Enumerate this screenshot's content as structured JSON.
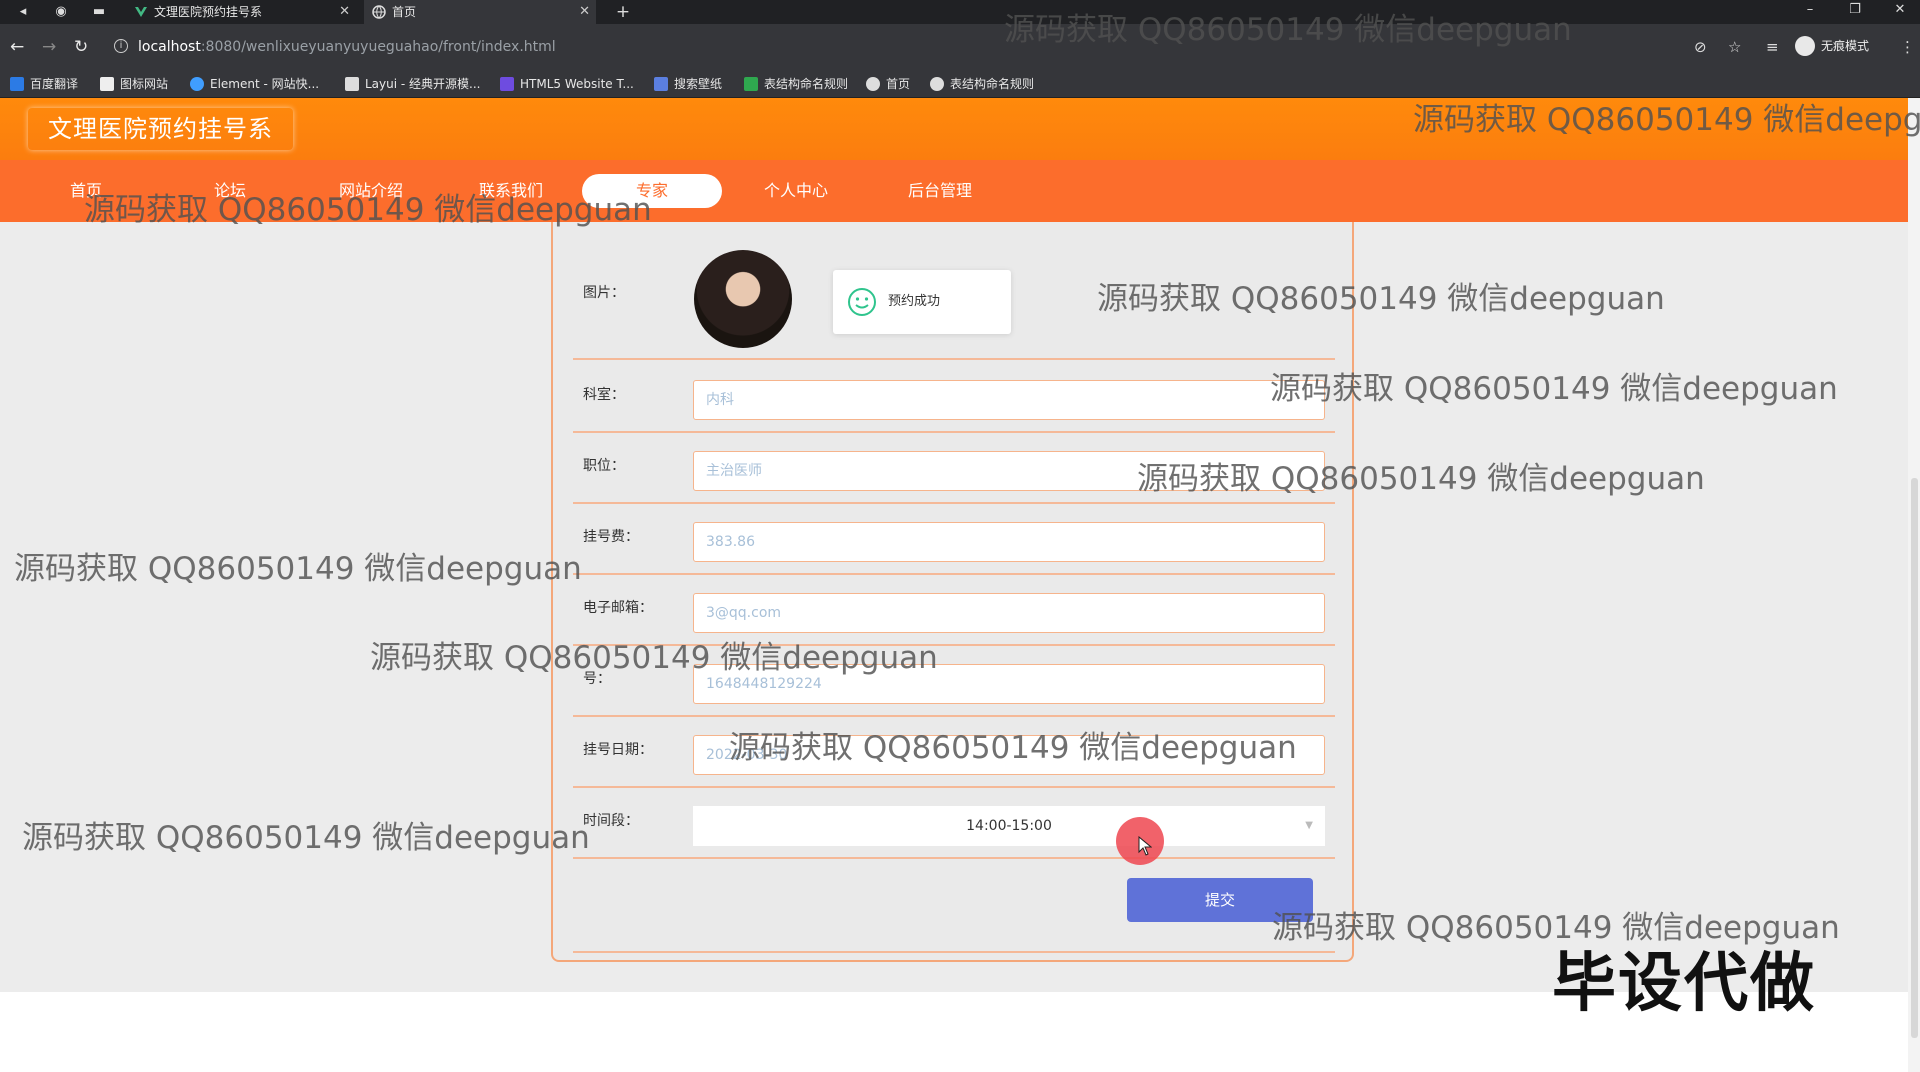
{
  "browser": {
    "tabs": [
      {
        "label": "文理医院预约挂号系",
        "active": false
      },
      {
        "label": "首页",
        "active": true
      }
    ],
    "url_host": "localhost",
    "url_path": ":8080/wenlixueyuanyuyueguahao/front/index.html",
    "incognito_label": "无痕模式",
    "bookmarks": [
      "百度翻译",
      "图标网站",
      "Element - 网站快...",
      "Layui - 经典开源模...",
      "HTML5 Website T...",
      "搜索壁纸",
      "表结构命名规则",
      "首页",
      "表结构命名规则"
    ]
  },
  "site": {
    "logo": "文理医院预约挂号系",
    "nav": [
      "首页",
      "论坛",
      "网站介绍",
      "联系我们",
      "专家",
      "个人中心",
      "后台管理"
    ],
    "active_nav": "专家",
    "accent_color": "#fc6d2c"
  },
  "form": {
    "picture_label": "图片：",
    "toast_text": "预约成功",
    "fields": [
      {
        "label": "科室：",
        "value": "内科"
      },
      {
        "label": "职位：",
        "value": "主治医师"
      },
      {
        "label": "挂号费：",
        "value": "383.86"
      },
      {
        "label": "电子邮箱：",
        "value": "3@qq.com"
      },
      {
        "label": "号：",
        "value": "1648448129224"
      },
      {
        "label": "挂号日期：",
        "value": "2022-03-30"
      }
    ],
    "time_label": "时间段：",
    "time_value": "14:00-15:00",
    "submit_label": "提交"
  },
  "watermarks": {
    "text": "源码获取 QQ86050149 微信deepguan",
    "text_cut": "源码获取 QQ86050149 微信deepgua",
    "big": "毕设代做"
  }
}
